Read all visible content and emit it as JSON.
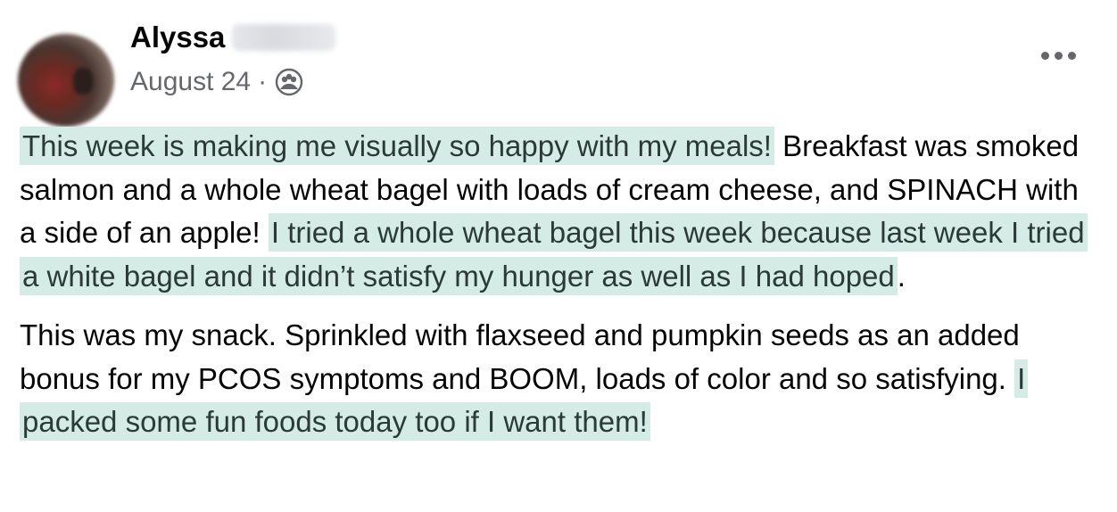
{
  "post": {
    "author_first_name": "Alyssa",
    "date": "August 24",
    "separator": "·",
    "audience_icon": "friends-icon",
    "more_icon": "more-options-icon",
    "paragraph1": {
      "highlight1": "This week is making me visually so happy with my meals!",
      "text1": " Breakfast was smoked salmon and a whole wheat bagel with loads of cream cheese, and SPINACH with a side of an apple! ",
      "highlight2": "I tried a whole wheat bagel this week because last week I tried a white bagel and it didn’t satisfy my hunger as well as I had hoped",
      "text2": "."
    },
    "paragraph2": {
      "text1": "This was my snack. Sprinkled with flaxseed and pumpkin seeds as an added bonus for my PCOS symptoms and BOOM, loads of color and so satisfying. ",
      "highlight1": "I packed some fun foods today too if I want them!"
    }
  },
  "colors": {
    "highlight": "#d5ebe6",
    "secondary_text": "#65676b",
    "primary_text": "#050505"
  }
}
